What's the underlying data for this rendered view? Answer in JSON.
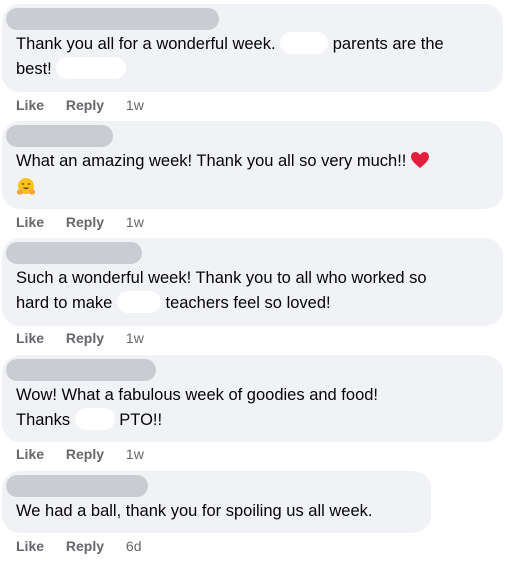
{
  "comments": [
    {
      "line1_a": "Thank you all for a wonderful week.",
      "line1_b": "parents are the",
      "line2": "best!",
      "like": "Like",
      "reply": "Reply",
      "time": "1w"
    },
    {
      "line1": "What an amazing week! Thank you all so very much!!",
      "heart_icon": "red-heart",
      "emoji_icon": "smiling-face-with-open-hands",
      "like": "Like",
      "reply": "Reply",
      "time": "1w"
    },
    {
      "line1": "Such a wonderful week! Thank you to all who worked so",
      "line2_a": "hard to make",
      "line2_b": "teachers feel so loved!",
      "like": "Like",
      "reply": "Reply",
      "time": "1w"
    },
    {
      "line1": "Wow! What a fabulous week of goodies and food!",
      "line2_a": "Thanks",
      "line2_b": "PTO!!",
      "like": "Like",
      "reply": "Reply",
      "time": "1w"
    },
    {
      "line1": "We had a ball, thank you for spoiling us all week.",
      "like": "Like",
      "reply": "Reply",
      "time": "6d"
    }
  ],
  "colors": {
    "bubble": "#f0f2f5",
    "redacted_name": "#c9ccd1",
    "action_text": "#65676b",
    "heart": "#e41e3f"
  }
}
